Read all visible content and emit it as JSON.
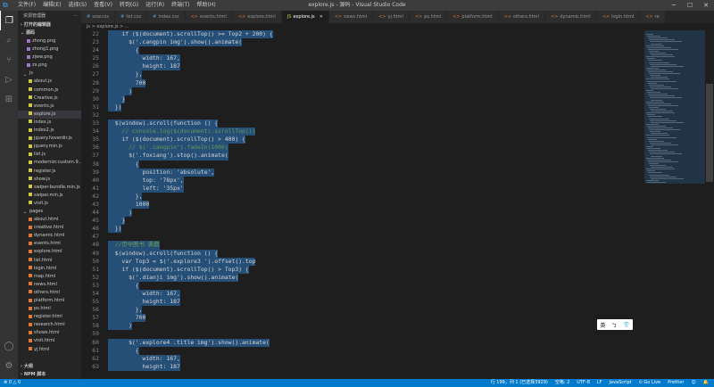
{
  "window": {
    "title": "explore.js - 源码 - Visual Studio Code",
    "menu": [
      "文件(F)",
      "编辑(E)",
      "选择(S)",
      "查看(V)",
      "转到(G)",
      "运行(R)",
      "终端(T)",
      "帮助(H)"
    ]
  },
  "sidebar": {
    "header": "资源管理器",
    "open_editors": "打开的编辑器",
    "folder": "源码",
    "files_top": [
      "zhong.png",
      "zhong1.png",
      "zjww.png",
      "zx.png"
    ],
    "js_folder": "js",
    "js_files": [
      "about.js",
      "common.js",
      "Creative.js",
      "events.js",
      "explore.js",
      "index.js",
      "index2.js",
      "jquery.hoverdir.js",
      "jquery.min.js",
      "list.js",
      "modernizr.custom.9...",
      "register.js",
      "show.js",
      "swiper-bundle.min.js",
      "swiper.min.js",
      "visit.js"
    ],
    "pages_folder": "pages",
    "page_files": [
      "about.html",
      "creative.html",
      "dynamic.html",
      "events.html",
      "explore.html",
      "list.html",
      "login.html",
      "map.html",
      "news.html",
      "others.html",
      "platform.html",
      "ps.html",
      "register.html",
      "research.html",
      "shows.html",
      "visit.html",
      "yj.html"
    ],
    "outline": "大纲",
    "npm": "NPM 脚本"
  },
  "tabs": [
    {
      "label": "sow.css",
      "type": "css"
    },
    {
      "label": "list.css",
      "type": "css"
    },
    {
      "label": "index.css",
      "type": "css"
    },
    {
      "label": "events.html",
      "type": "html"
    },
    {
      "label": "explore.html",
      "type": "html"
    },
    {
      "label": "explore.js",
      "type": "js",
      "active": true
    },
    {
      "label": "news.html",
      "type": "html"
    },
    {
      "label": "yj.html",
      "type": "html"
    },
    {
      "label": "ps.html",
      "type": "html"
    },
    {
      "label": "platform.html",
      "type": "html"
    },
    {
      "label": "others.html",
      "type": "html"
    },
    {
      "label": "dynamic.html",
      "type": "html"
    },
    {
      "label": "login.html",
      "type": "html"
    },
    {
      "label": "re",
      "type": "html"
    }
  ],
  "breadcrumb": "js > explore.js > ...",
  "code_lines": [
    {
      "n": "22",
      "t": "    if ($(document).scrollTop() >= Top2 + 200) {"
    },
    {
      "n": "23",
      "t": "      $('.cangpin img').show().animate("
    },
    {
      "n": "24",
      "t": "        {"
    },
    {
      "n": "25",
      "t": "          width: 167,"
    },
    {
      "n": "26",
      "t": "          height: 187"
    },
    {
      "n": "27",
      "t": "        },"
    },
    {
      "n": "28",
      "t": "        700"
    },
    {
      "n": "29",
      "t": "      )"
    },
    {
      "n": "30",
      "t": "    }"
    },
    {
      "n": "31",
      "t": "  })"
    },
    {
      "n": "32",
      "t": ""
    },
    {
      "n": "33",
      "t": "  $(window).scroll(function () {"
    },
    {
      "n": "34",
      "t": "    // console.log($(document).scrollTop())"
    },
    {
      "n": "35",
      "t": "    if ($(document).scrollTop() > 400) {"
    },
    {
      "n": "36",
      "t": "      // $('.cangpin').fadeIn(1000)"
    },
    {
      "n": "37",
      "t": "      $('.foxiang').stop().animate("
    },
    {
      "n": "38",
      "t": "        {"
    },
    {
      "n": "39",
      "t": "          position: 'absolute',"
    },
    {
      "n": "40",
      "t": "          top: '78px',"
    },
    {
      "n": "41",
      "t": "          left: '35px'"
    },
    {
      "n": "42",
      "t": "        },"
    },
    {
      "n": "43",
      "t": "        1000"
    },
    {
      "n": "44",
      "t": "      )"
    },
    {
      "n": "45",
      "t": "    }"
    },
    {
      "n": "46",
      "t": "  })"
    },
    {
      "n": "47",
      "t": ""
    },
    {
      "n": "48",
      "t": "  //页中图书 典籍"
    },
    {
      "n": "49",
      "t": "  $(window).scroll(function () {"
    },
    {
      "n": "50",
      "t": "    var Top3 = $('.explore3 ').offset().top"
    },
    {
      "n": "51",
      "t": "    if ($(document).scrollTop() > Top3) {"
    },
    {
      "n": "52",
      "t": "      $('.dianji img').show().animate("
    },
    {
      "n": "53",
      "t": "        {"
    },
    {
      "n": "54",
      "t": "          width: 167,"
    },
    {
      "n": "55",
      "t": "          height: 187"
    },
    {
      "n": "56",
      "t": "        },"
    },
    {
      "n": "57",
      "t": "        700"
    },
    {
      "n": "58",
      "t": "      )"
    },
    {
      "n": "59",
      "t": ""
    },
    {
      "n": "60",
      "t": "      $('.explore4 .title img').show().animate("
    },
    {
      "n": "61",
      "t": "        {"
    },
    {
      "n": "62",
      "t": "          width: 167,"
    },
    {
      "n": "63",
      "t": "          height: 187"
    }
  ],
  "ime": {
    "a": "英",
    "b": "ㄅ",
    "c": "👕"
  },
  "status": {
    "errors": "⊗ 0 △ 0",
    "position": "行 199，列 1 (已选择3929)",
    "spaces": "空格: 2",
    "encoding": "UTF-8",
    "eol": "LF",
    "language": "JavaScript",
    "golive": "⊙ Go Live",
    "prettier": "Prettier"
  },
  "colors": {
    "accent": "#007acc",
    "selection": "#264f78",
    "editor_bg": "#1e1e1e"
  }
}
